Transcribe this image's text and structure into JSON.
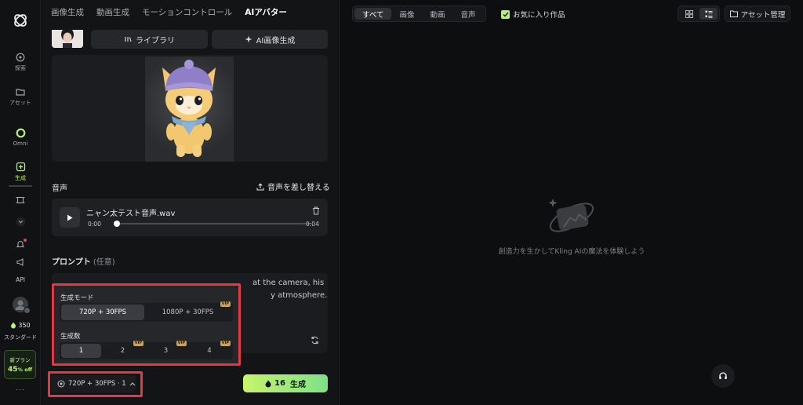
{
  "rail": {
    "items": [
      {
        "label": "探索"
      },
      {
        "label": "アセット"
      },
      {
        "label": "Omni"
      },
      {
        "label": "生成"
      },
      {
        "label": ""
      },
      {
        "label": ""
      },
      {
        "label": ""
      },
      {
        "label": ""
      },
      {
        "label": "API"
      }
    ],
    "credits": "350",
    "plan": "スタンダード",
    "promo_title": "新プラン",
    "promo_discount": "45",
    "promo_suffix": "% off",
    "more": "..."
  },
  "panel": {
    "tabs": [
      "画像生成",
      "動画生成",
      "モーションコントロール",
      "AIアバター"
    ],
    "active_tab": "AIアバター",
    "library_label": "ライブラリ",
    "ai_image_label": "AI画像生成",
    "audio_section_title": "音声",
    "replace_audio_label": "音声を差し替える",
    "audio": {
      "filename": "ニャン太テスト音声.wav",
      "current": "0:00",
      "duration": "0:04",
      "progress": 0
    },
    "prompt_title": "プロンプト",
    "prompt_optional": "(任意)",
    "prompt_visible_line1_end": "at the camera, his",
    "prompt_visible_line2_end": "y atmosphere.",
    "popover": {
      "mode_label": "生成モード",
      "mode_options": [
        {
          "label": "720P + 30FPS",
          "selected": true,
          "vip": false
        },
        {
          "label": "1080P + 30FPS",
          "selected": false,
          "vip": true
        }
      ],
      "count_label": "生成数",
      "count_options": [
        {
          "label": "1",
          "selected": true,
          "vip": false
        },
        {
          "label": "2",
          "selected": false,
          "vip": true
        },
        {
          "label": "3",
          "selected": false,
          "vip": true
        },
        {
          "label": "4",
          "selected": false,
          "vip": true
        }
      ],
      "vip_badge": "VIP"
    },
    "mode_chip_label": "720P + 30FPS · 1",
    "generate_cost": "16",
    "generate_label": "生成"
  },
  "right": {
    "filters": [
      "すべて",
      "画像",
      "動画",
      "音声"
    ],
    "active_filter": "すべて",
    "favorite_label": "お気に入り作品",
    "favorite_checked": true,
    "asset_manage_label": "アセット管理",
    "empty_message": "創造力を生かしてKling AIの魔法を体験しよう"
  },
  "colors": {
    "accent": "#b8f27c",
    "highlight": "#e03b45",
    "vip": "#c9a25d"
  }
}
